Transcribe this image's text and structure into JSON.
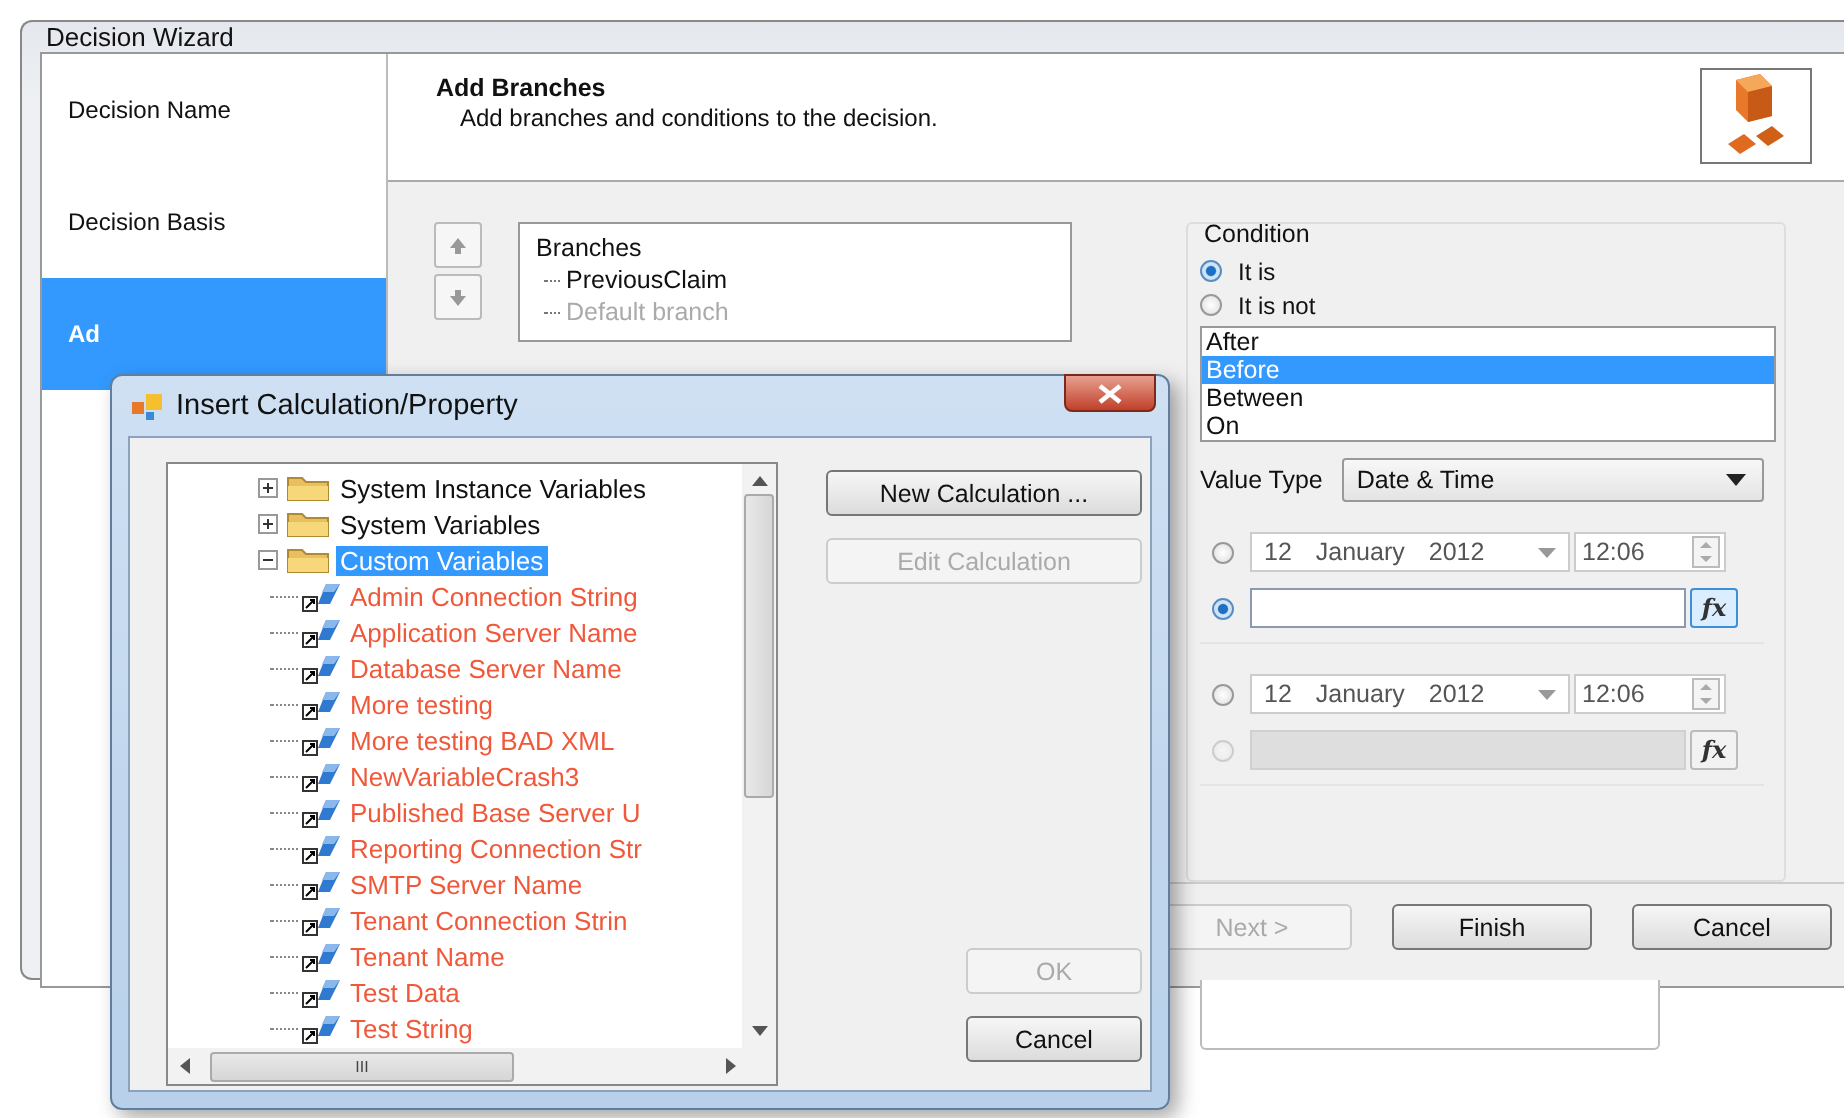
{
  "window": {
    "title": "Decision Wizard"
  },
  "steps": [
    {
      "label": "Decision Name",
      "selected": false
    },
    {
      "label": "Decision Basis",
      "selected": false
    },
    {
      "label": "Ad",
      "selected": true
    }
  ],
  "header": {
    "title": "Add Branches",
    "subtitle": "Add branches and conditions to the decision."
  },
  "branches": {
    "root": "Branches",
    "children": [
      {
        "label": "PreviousClaim",
        "disabled": false
      },
      {
        "label": "Default branch",
        "disabled": true
      }
    ]
  },
  "condition": {
    "title": "Condition",
    "options": [
      {
        "label": "It is",
        "selected": true
      },
      {
        "label": "It is not",
        "selected": false
      }
    ],
    "operators": [
      {
        "label": "After",
        "selected": false
      },
      {
        "label": "Before",
        "selected": true
      },
      {
        "label": "Between",
        "selected": false
      },
      {
        "label": "On",
        "selected": false
      }
    ],
    "value_type_label": "Value Type",
    "value_type": "Date & Time",
    "value_groups": [
      {
        "day": "12",
        "month": "January",
        "year": "2012",
        "time": "12:06",
        "date_selected": false,
        "expression_selected": true,
        "expression_disabled": false,
        "expression_button": "fx"
      },
      {
        "day": "12",
        "month": "January",
        "year": "2012",
        "time": "12:06",
        "date_selected": false,
        "expression_selected": false,
        "expression_disabled": true,
        "expression_button": "fx"
      }
    ]
  },
  "wizard_buttons": [
    {
      "label": "Next >",
      "disabled": true
    },
    {
      "label": "Finish",
      "disabled": false
    },
    {
      "label": "Cancel",
      "disabled": false
    }
  ],
  "dialog": {
    "title": "Insert Calculation/Property",
    "tree": [
      {
        "label": "System Instance Variables",
        "expanded": false,
        "selected": false
      },
      {
        "label": "System Variables",
        "expanded": false,
        "selected": false
      },
      {
        "label": "Custom Variables",
        "expanded": true,
        "selected": true,
        "children": [
          {
            "label": "Admin Connection String"
          },
          {
            "label": "Application Server Name"
          },
          {
            "label": "Database Server Name"
          },
          {
            "label": "More testing"
          },
          {
            "label": "More testing BAD XML"
          },
          {
            "label": "NewVariableCrash3"
          },
          {
            "label": "Published Base Server U"
          },
          {
            "label": "Reporting Connection Str"
          },
          {
            "label": "SMTP Server Name"
          },
          {
            "label": "Tenant Connection Strin"
          },
          {
            "label": "Tenant Name"
          },
          {
            "label": "Test Data"
          },
          {
            "label": "Test String"
          }
        ]
      }
    ],
    "scroll_thumb_label": "III",
    "buttons": [
      {
        "label": "New Calculation ...",
        "disabled": false,
        "kind": "top"
      },
      {
        "label": "Edit Calculation",
        "disabled": true,
        "kind": "top"
      },
      {
        "label": "OK",
        "disabled": true,
        "kind": "bottom"
      },
      {
        "label": "Cancel",
        "disabled": false,
        "kind": "bottom"
      }
    ]
  }
}
